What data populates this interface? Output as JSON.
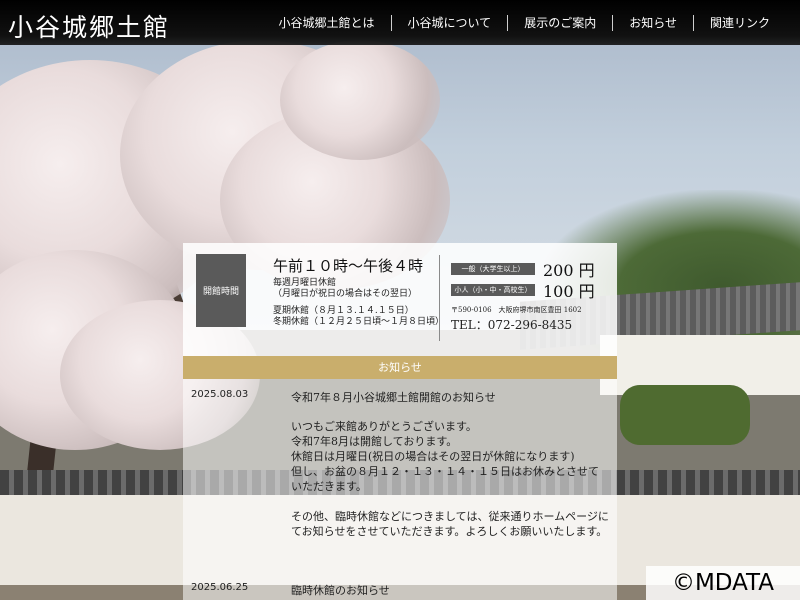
{
  "header": {
    "logo": "小谷城郷土館",
    "nav": [
      "小谷城郷土館とは",
      "小谷城について",
      "展示のご案内",
      "お知らせ",
      "関連リンク"
    ]
  },
  "info": {
    "hours_label": "開館時間",
    "hours": "午前１０時～午後４時",
    "closed_weekly": "毎週月曜日休館\n（月曜日が祝日の場合はその翌日）",
    "closed_seasonal": "夏期休館（８月１３.１４.１５日）\n冬期休館（１２月２５日頃～１月８日頃）",
    "fees": [
      {
        "label": "一般（大学生以上）",
        "price": "200 円"
      },
      {
        "label": "小人（小・中・高校生）",
        "price": "100 円"
      }
    ],
    "address": "〒590-0106　大阪府堺市南区豊田 1602",
    "tel": "TEL：072-296-8435"
  },
  "news": {
    "heading": "お知らせ",
    "items": [
      {
        "date": "2025.08.03",
        "title": "令和7年８月小谷城郷土館開館のお知らせ",
        "body": "いつもご来館ありがとうございます。\n令和7年8月は開館しております。\n休館日は月曜日(祝日の場合はその翌日が休館になります)\n但し、お盆の８月１２・１３・１４・１５日はお休みとさせていただきます。\n\nその他、臨時休館などにつきましては、従来通りホームページにてお知らせをさせていただきます。よろしくお願いいたします。"
      },
      {
        "date": "2025.06.25",
        "title": "臨時休館のお知らせ",
        "body": ""
      }
    ]
  },
  "watermark": "©MDATA"
}
